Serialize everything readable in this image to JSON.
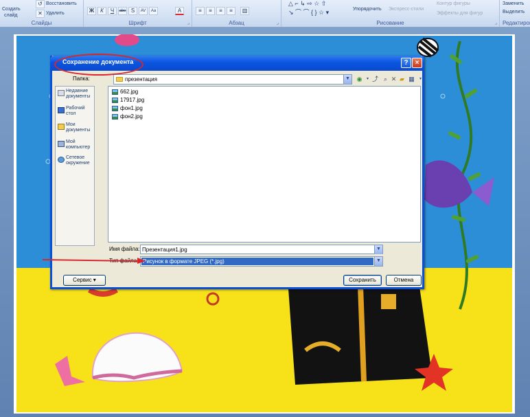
{
  "ribbon": {
    "slides": {
      "create_label": "Создать",
      "slide_label": "слайд",
      "restore_label": "Восстановить",
      "delete_label": "Удалить",
      "group_label": "Слайды"
    },
    "font": {
      "group_label": "Шрифт",
      "buttons": [
        "Ж",
        "К",
        "Ч",
        "abe",
        "S",
        "AV",
        "Aa",
        "A"
      ]
    },
    "paragraph": {
      "group_label": "Абзац"
    },
    "drawing": {
      "arrange_label": "Упорядочить",
      "quick_styles_label": "Экспресс-стили",
      "shape_outline_label": "Контур фигуры",
      "shape_effects_label": "Эффекты для фигур",
      "group_label": "Рисование"
    },
    "editing": {
      "replace_label": "Заменить",
      "select_label": "Выделить",
      "group_label": "Редактирова"
    }
  },
  "dialog": {
    "title": "Сохранение документа",
    "help_glyph": "?",
    "close_glyph": "×",
    "folder_label": "Папка:",
    "folder_value": "презентация",
    "places": [
      {
        "label": "Недавние документы",
        "icon": "recent-docs-icon"
      },
      {
        "label": "Рабочий стол",
        "icon": "desktop-icon"
      },
      {
        "label": "Мои документы",
        "icon": "my-documents-icon"
      },
      {
        "label": "Мой компьютер",
        "icon": "my-computer-icon"
      },
      {
        "label": "Сетевое окружение",
        "icon": "network-icon"
      }
    ],
    "files": [
      "662.jpg",
      "17917.jpg",
      "фон1.jpg",
      "фон2.jpg"
    ],
    "filename_label": "Имя файла:",
    "filename_value": "Презентация1.jpg",
    "filetype_label": "Тип файла:",
    "filetype_value": "Рисунок в формате JPEG (*.jpg)",
    "service_label": "Сервис",
    "save_label": "Сохранить",
    "cancel_label": "Отмена"
  },
  "colors": {
    "titlebar": "#0a4fd8",
    "dialog_bg": "#ece9d8",
    "selection": "#316ac5",
    "annotation": "#d8262c",
    "sea": "#2d8ed8",
    "sand": "#f7e21a"
  }
}
